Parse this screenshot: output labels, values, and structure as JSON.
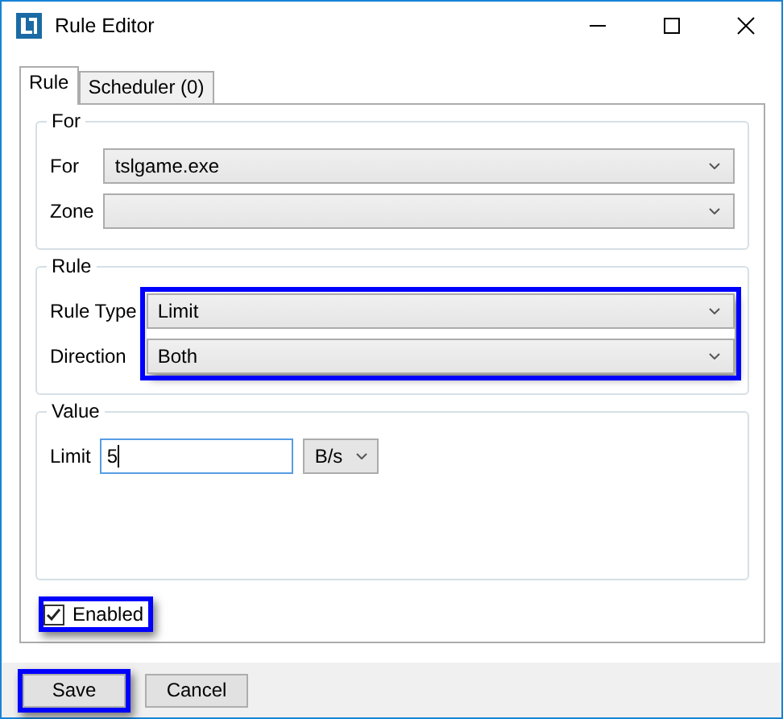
{
  "window": {
    "title": "Rule Editor"
  },
  "tabs": [
    {
      "label": "Rule",
      "selected": true
    },
    {
      "label": "Scheduler (0)",
      "selected": false
    }
  ],
  "groups": [
    {
      "title": "For",
      "highlighted": false,
      "fields": [
        {
          "kind": "dropdown",
          "label": "For",
          "value": "tslgame.exe"
        },
        {
          "kind": "dropdown",
          "label": "Zone"
        }
      ]
    },
    {
      "title": "Rule",
      "highlighted": true,
      "fields": [
        {
          "kind": "dropdown",
          "label": "Rule Type",
          "value": "Limit"
        },
        {
          "kind": "dropdown",
          "label": "Direction",
          "value": "Both"
        }
      ]
    },
    {
      "title": "Value",
      "highlighted": false,
      "fields": [
        {
          "kind": "input",
          "label": "Limit",
          "value": "5",
          "unit": "B/s"
        }
      ]
    }
  ],
  "enabled": {
    "label": "Enabled",
    "checked": true,
    "highlighted": true
  },
  "buttons": [
    {
      "label": "Save",
      "highlighted": true
    },
    {
      "label": "Cancel",
      "highlighted": false
    }
  ]
}
